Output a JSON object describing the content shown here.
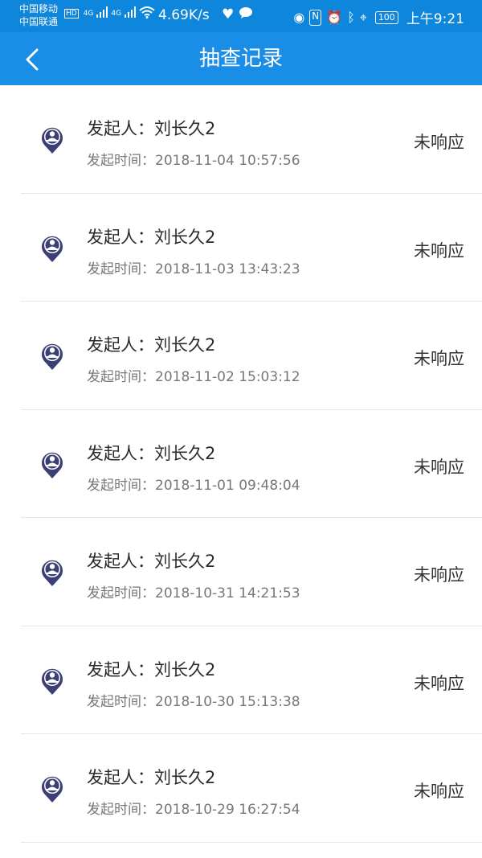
{
  "status_bar": {
    "carrier_1": "中国移动",
    "carrier_2": "中国联通",
    "hd_badge": "HD",
    "net_1": "4G",
    "net_2": "4G",
    "speed": "4.69K/s",
    "battery": "100",
    "time": "上午9:21"
  },
  "navbar": {
    "title": "抽查记录",
    "back_icon": "chevron-left-icon"
  },
  "records": [
    {
      "initiator": "发起人：刘长久2",
      "time": "发起时间：2018-11-04 10:57:56",
      "status": "未响应"
    },
    {
      "initiator": "发起人：刘长久2",
      "time": "发起时间：2018-11-03 13:43:23",
      "status": "未响应"
    },
    {
      "initiator": "发起人：刘长久2",
      "time": "发起时间：2018-11-02 15:03:12",
      "status": "未响应"
    },
    {
      "initiator": "发起人：刘长久2",
      "time": "发起时间：2018-11-01 09:48:04",
      "status": "未响应"
    },
    {
      "initiator": "发起人：刘长久2",
      "time": "发起时间：2018-10-31 14:21:53",
      "status": "未响应"
    },
    {
      "initiator": "发起人：刘长久2",
      "time": "发起时间：2018-10-30 15:13:38",
      "status": "未响应"
    },
    {
      "initiator": "发起人：刘长久2",
      "time": "发起时间：2018-10-29 16:27:54",
      "status": "未响应"
    }
  ],
  "colors": {
    "header": "#1a8ee6",
    "status_bar": "#0d86db",
    "avatar": "#3b3f74"
  }
}
